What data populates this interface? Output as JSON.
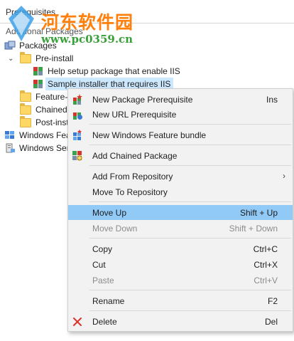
{
  "header": {
    "title": "Prerequisites",
    "subtitle": "Additional Packages"
  },
  "watermark": {
    "line1": "河东软件园",
    "line2": "www.pc0359.cn"
  },
  "tree": {
    "packages": "Packages",
    "pre_install": "Pre-install",
    "item1": "Help setup package that enable IIS",
    "item2": "Sample installer that requires IIS",
    "feature": "Feature-b",
    "chained": "Chained",
    "post": "Post-inst",
    "win_features": "Windows Featu",
    "win_server": "Windows Ser"
  },
  "menu": {
    "new_pkg": {
      "label": "New Package Prerequisite",
      "shortcut": "Ins"
    },
    "new_url": {
      "label": "New URL Prerequisite",
      "shortcut": ""
    },
    "new_wf": {
      "label": "New Windows Feature bundle",
      "shortcut": ""
    },
    "add_chained": {
      "label": "Add Chained Package",
      "shortcut": ""
    },
    "add_repo": {
      "label": "Add From Repository",
      "shortcut": ""
    },
    "move_repo": {
      "label": "Move To Repository",
      "shortcut": ""
    },
    "move_up": {
      "label": "Move Up",
      "shortcut": "Shift + Up"
    },
    "move_down": {
      "label": "Move Down",
      "shortcut": "Shift + Down"
    },
    "copy": {
      "label": "Copy",
      "shortcut": "Ctrl+C"
    },
    "cut": {
      "label": "Cut",
      "shortcut": "Ctrl+X"
    },
    "paste": {
      "label": "Paste",
      "shortcut": "Ctrl+V"
    },
    "rename": {
      "label": "Rename",
      "shortcut": "F2"
    },
    "delete": {
      "label": "Delete",
      "shortcut": "Del"
    }
  },
  "colors": {
    "highlight": "#91c9f7",
    "selection": "#cce8ff",
    "watermark_orange": "#ff7a00",
    "watermark_green": "#2e9b2e"
  }
}
